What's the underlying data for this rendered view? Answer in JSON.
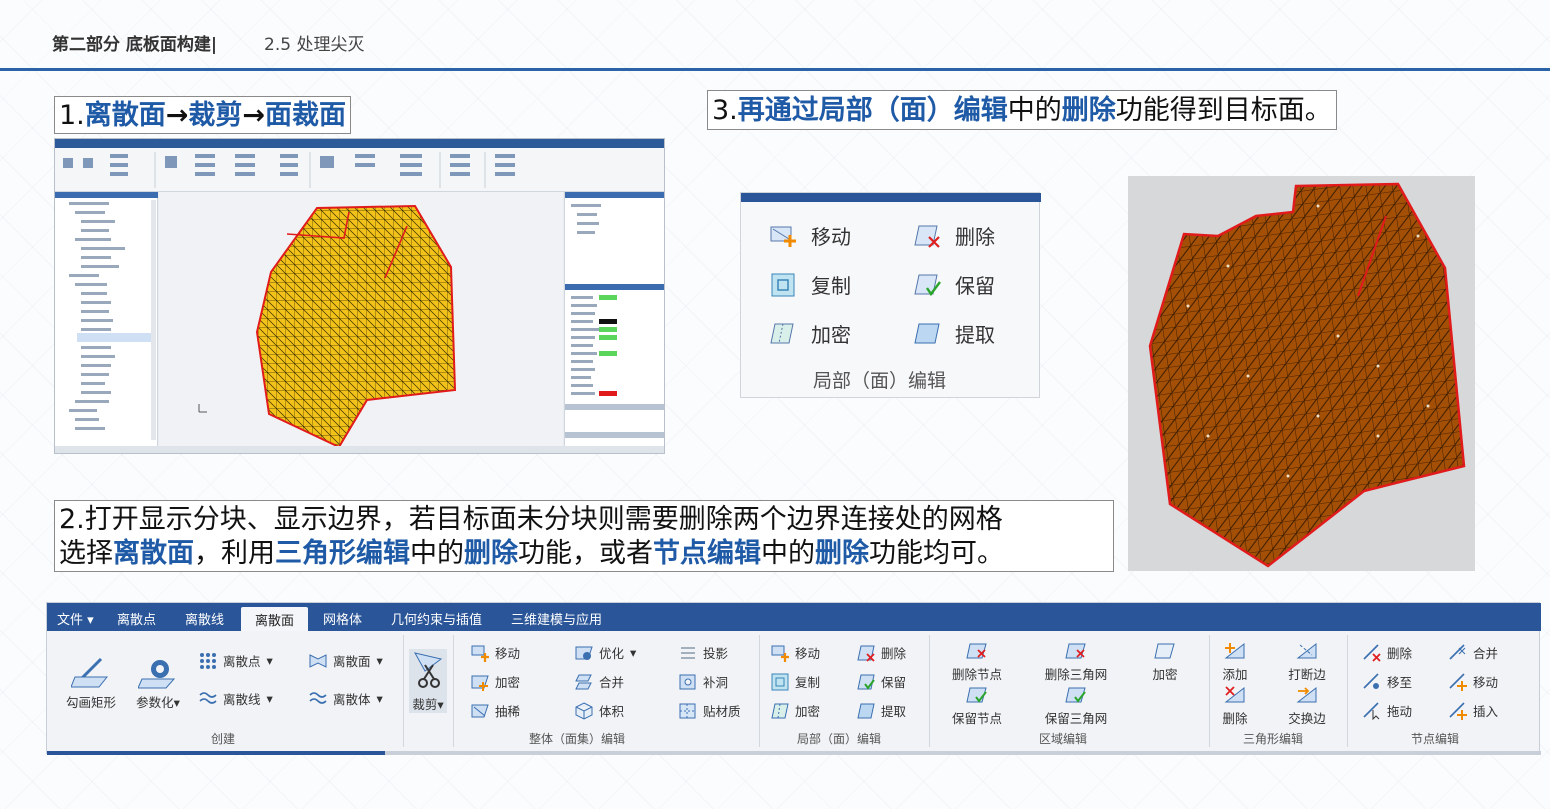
{
  "header": {
    "title_main": "第二部分 底板面构建|",
    "title_sub": "2.5 处理尖灭"
  },
  "step1": {
    "num": "1.",
    "a": "离散面",
    "arrow1": "→",
    "b": "裁剪",
    "arrow2": "→",
    "c": "面裁面"
  },
  "step3": {
    "num": "3.",
    "a": "再通过局部（面）编辑",
    "b": "中的",
    "c": "删除",
    "d": "功能得到目标面。"
  },
  "step2": {
    "line1": "2.打开显示分块、显示边界，若目标面未分块则需要删除两个边界连接处的网格",
    "l2_a": "选择",
    "l2_b": "离散面",
    "l2_c": "，利用",
    "l2_d": "三角形编辑",
    "l2_e": "中的",
    "l2_f": "删除",
    "l2_g": "功能，或者",
    "l2_h": "节点编辑",
    "l2_i": "中的",
    "l2_j": "删除",
    "l2_k": "功能均可。"
  },
  "local_panel": {
    "move": "移动",
    "delete": "删除",
    "copy": "复制",
    "keep": "保留",
    "densify": "加密",
    "extract": "提取",
    "caption": "局部（面）编辑"
  },
  "toolbar": {
    "tabs": [
      "文件",
      "离散点",
      "离散线",
      "离散面",
      "网格体",
      "几何约束与插值",
      "三维建模与应用"
    ],
    "create": {
      "rect": "勾画矩形",
      "param": "参数化",
      "points": "离散点",
      "lines": "离散线",
      "surface": "离散面",
      "volume": "离散体",
      "label": "创建"
    },
    "cut": "裁剪",
    "whole": {
      "move": "移动",
      "optimize": "优化",
      "project": "投影",
      "densify": "加密",
      "merge": "合并",
      "fill": "补洞",
      "thin": "抽稀",
      "volume": "体积",
      "texture": "贴材质",
      "label": "整体（面集）编辑"
    },
    "local": {
      "move": "移动",
      "delete": "删除",
      "copy": "复制",
      "keep": "保留",
      "densify": "加密",
      "extract": "提取",
      "label": "局部（面）编辑"
    },
    "region": {
      "del_node": "删除节点",
      "del_tri": "删除三角网",
      "densify": "加密",
      "keep_node": "保留节点",
      "keep_tri": "保留三角网",
      "label": "区域编辑"
    },
    "triangle": {
      "add": "添加",
      "break_edge": "打断边",
      "delete": "删除",
      "swap_edge": "交换边",
      "label": "三角形编辑"
    },
    "node": {
      "delete": "删除",
      "merge": "合并",
      "move_to": "移至",
      "move": "移动",
      "drag": "拖动",
      "insert": "插入",
      "label": "节点编辑"
    }
  },
  "colors": {
    "accent_blue": "#1f5aa6",
    "ribbon_blue": "#2a5598",
    "mesh_yellow": "#f2c21a",
    "mesh_brown": "#a34f05",
    "boundary_red": "#e11b1b"
  }
}
